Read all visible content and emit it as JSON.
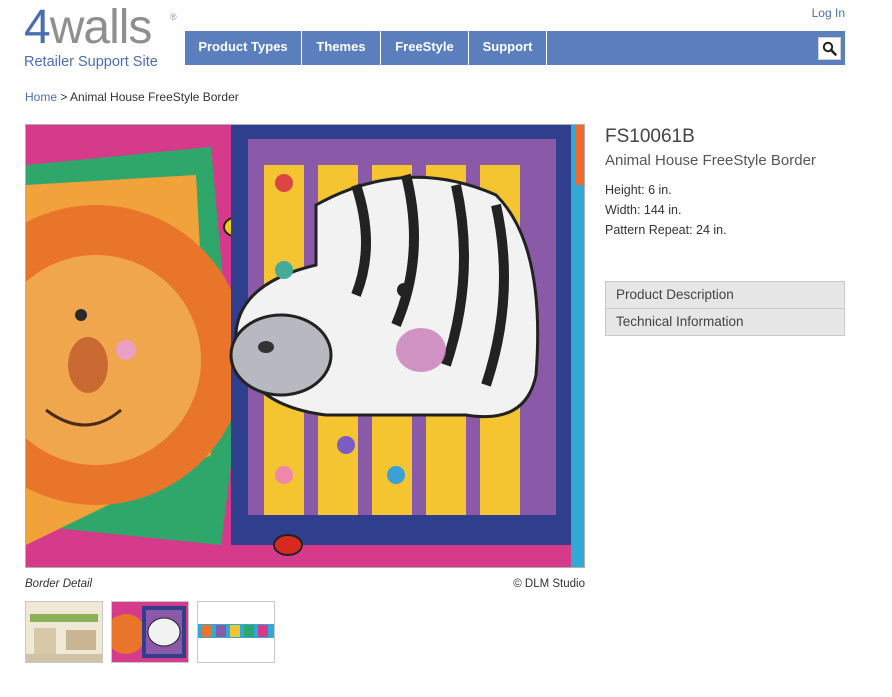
{
  "header": {
    "logo": {
      "mark_number": "4",
      "mark_word": "walls",
      "reg": "®",
      "subtitle": "Retailer Support Site"
    },
    "login_label": "Log In",
    "nav": [
      {
        "label": "Product Types"
      },
      {
        "label": "Themes"
      },
      {
        "label": "FreeStyle"
      },
      {
        "label": "Support"
      }
    ],
    "search_icon": "search-icon"
  },
  "breadcrumb": {
    "home": "Home",
    "separator": " > ",
    "current": "Animal House FreeStyle Border"
  },
  "product": {
    "code": "FS10061B",
    "name": "Animal House FreeStyle Border",
    "specs": [
      "Height: 6 in.",
      "Width: 144 in.",
      "Pattern Repeat: 24 in."
    ]
  },
  "image": {
    "caption": "Border Detail",
    "credit": "© DLM Studio"
  },
  "accordion": [
    {
      "label": "Product Description"
    },
    {
      "label": "Technical Information"
    }
  ],
  "colors": {
    "brand_blue": "#4a6faf",
    "nav_blue": "#5b7fbd",
    "panel_gray": "#e6e6e6"
  }
}
